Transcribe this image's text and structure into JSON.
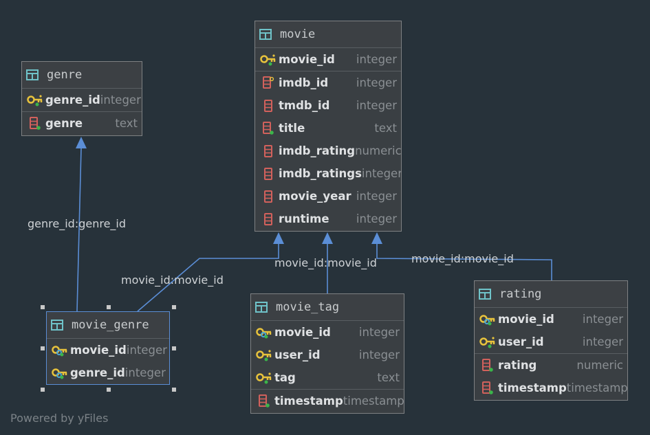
{
  "tables": [
    {
      "id": "movie",
      "name": "movie",
      "sections": [
        [
          {
            "name": "movie_id",
            "type": "integer",
            "icon": "primary-key-icon"
          }
        ],
        [
          {
            "name": "imdb_id",
            "type": "integer",
            "icon": "unique-column-icon"
          },
          {
            "name": "tmdb_id",
            "type": "integer",
            "icon": "column-icon"
          },
          {
            "name": "title",
            "type": "text",
            "icon": "not-null-column-icon"
          },
          {
            "name": "imdb_rating",
            "type": "numeric",
            "icon": "column-icon"
          },
          {
            "name": "imdb_ratings",
            "type": "integer",
            "icon": "column-icon"
          },
          {
            "name": "movie_year",
            "type": "integer",
            "icon": "column-icon"
          },
          {
            "name": "runtime",
            "type": "integer",
            "icon": "column-icon"
          }
        ]
      ]
    },
    {
      "id": "genre",
      "name": "genre",
      "sections": [
        [
          {
            "name": "genre_id",
            "type": "integer",
            "icon": "primary-key-icon"
          }
        ],
        [
          {
            "name": "genre",
            "type": "text",
            "icon": "not-null-column-icon"
          }
        ]
      ]
    },
    {
      "id": "movie_genre",
      "name": "movie_genre",
      "selected": true,
      "sections": [
        [
          {
            "name": "movie_id",
            "type": "integer",
            "icon": "primary-foreign-key-icon"
          },
          {
            "name": "genre_id",
            "type": "integer",
            "icon": "primary-foreign-key-icon"
          }
        ]
      ]
    },
    {
      "id": "movie_tag",
      "name": "movie_tag",
      "sections": [
        [
          {
            "name": "movie_id",
            "type": "integer",
            "icon": "primary-foreign-key-icon"
          },
          {
            "name": "user_id",
            "type": "integer",
            "icon": "primary-key-icon"
          },
          {
            "name": "tag",
            "type": "text",
            "icon": "primary-key-icon"
          }
        ],
        [
          {
            "name": "timestamp",
            "type": "timestamp",
            "icon": "not-null-column-icon"
          }
        ]
      ]
    },
    {
      "id": "rating",
      "name": "rating",
      "sections": [
        [
          {
            "name": "movie_id",
            "type": "integer",
            "icon": "primary-foreign-key-icon"
          },
          {
            "name": "user_id",
            "type": "integer",
            "icon": "primary-key-icon"
          }
        ],
        [
          {
            "name": "rating",
            "type": "numeric",
            "icon": "not-null-column-icon"
          },
          {
            "name": "timestamp",
            "type": "timestamp",
            "icon": "not-null-column-icon"
          }
        ]
      ]
    }
  ],
  "relations": [
    {
      "id": "mg-genre",
      "label": "genre_id:genre_id"
    },
    {
      "id": "mg-movie",
      "label": "movie_id:movie_id"
    },
    {
      "id": "mt-movie",
      "label": "movie_id:movie_id"
    },
    {
      "id": "r-movie",
      "label": "movie_id:movie_id"
    }
  ],
  "colors": {
    "edge": "#5b8ed6",
    "key": "#e8c33c",
    "fk": "#4aa8d8",
    "column": "#d2615c",
    "notnull": "#3bb54a",
    "table_icon": "#6fc3c9"
  },
  "footer": {
    "powered_by": "Powered by yFiles"
  }
}
